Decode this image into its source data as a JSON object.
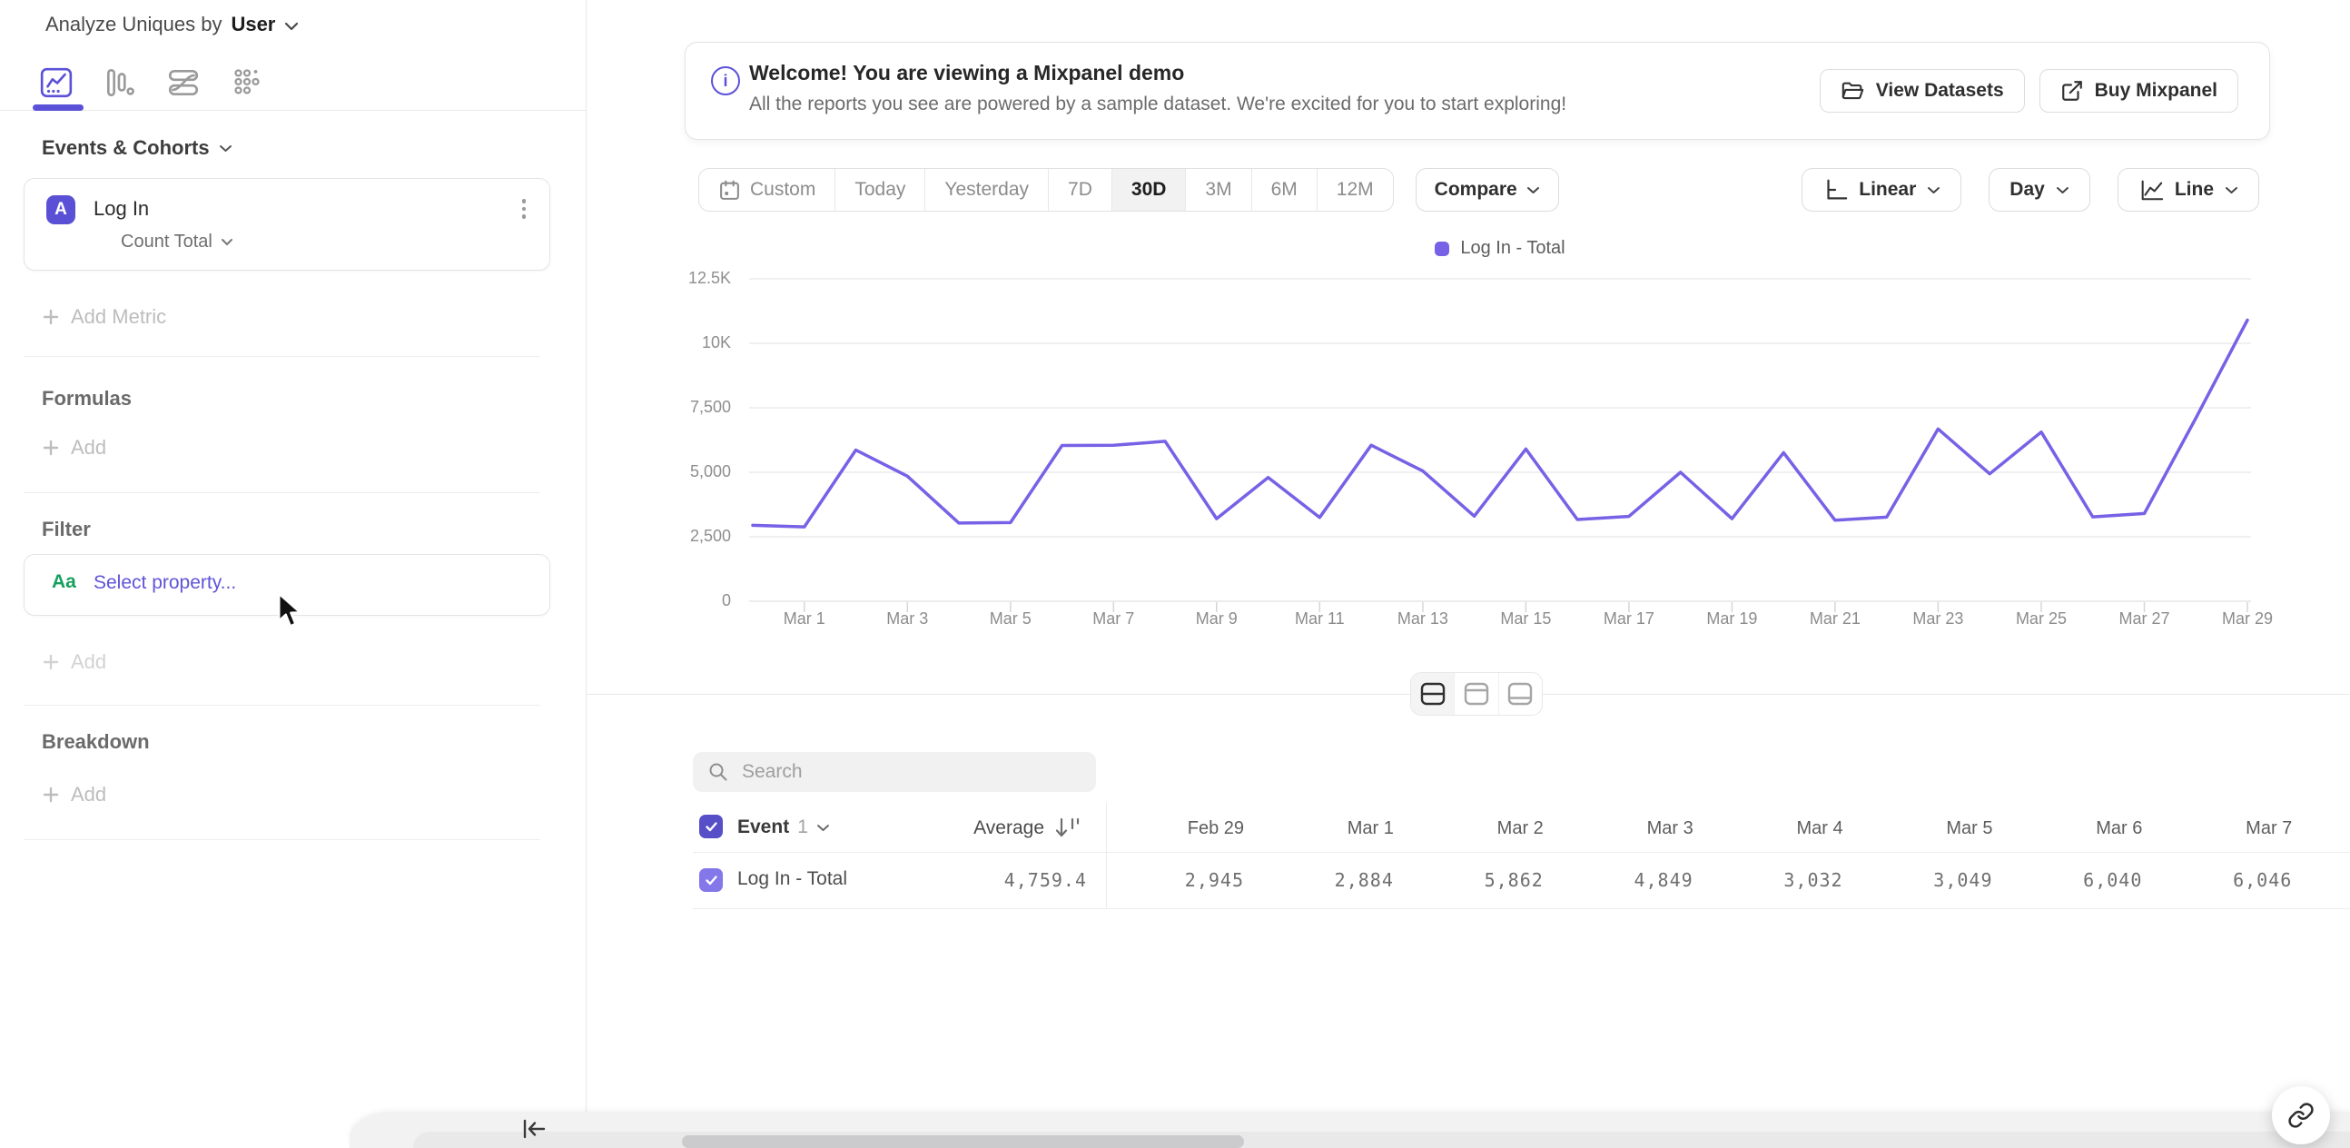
{
  "sidebar": {
    "header": {
      "prefix": "Analyze Uniques by",
      "unit_selector": "User"
    },
    "tabs": [
      {
        "name": "insights",
        "active": true
      },
      {
        "name": "bar-chart",
        "active": false
      },
      {
        "name": "flows",
        "active": false
      },
      {
        "name": "retention",
        "active": false
      }
    ],
    "events": {
      "title": "Events & Cohorts",
      "metric": {
        "badge": "A",
        "event": "Log In",
        "aggregation": "Count Total"
      },
      "add_metric_label": "Add Metric"
    },
    "formulas": {
      "title": "Formulas",
      "add_label": "Add"
    },
    "filter": {
      "title": "Filter",
      "property_type": "Aa",
      "select_label": "Select property...",
      "add_label": "Add"
    },
    "breakdown": {
      "title": "Breakdown",
      "add_label": "Add"
    }
  },
  "banner": {
    "title": "Welcome! You are viewing a Mixpanel demo",
    "subtitle": "All the reports you see are powered by a sample dataset. We're excited for you to start exploring!",
    "buttons": [
      {
        "label": "View Datasets"
      },
      {
        "label": "Buy Mixpanel"
      }
    ]
  },
  "toolbar": {
    "ranges": [
      "Custom",
      "Today",
      "Yesterday",
      "7D",
      "30D",
      "3M",
      "6M",
      "12M"
    ],
    "active_range": "30D",
    "compare_label": "Compare",
    "scale_label": "Linear",
    "interval_label": "Day",
    "chart_type_label": "Line"
  },
  "chart_data": {
    "type": "line",
    "x": [
      "Feb 29",
      "Mar 1",
      "Mar 2",
      "Mar 3",
      "Mar 4",
      "Mar 5",
      "Mar 6",
      "Mar 7",
      "Mar 8",
      "Mar 9",
      "Mar 10",
      "Mar 11",
      "Mar 12",
      "Mar 13",
      "Mar 14",
      "Mar 15",
      "Mar 16",
      "Mar 17",
      "Mar 18",
      "Mar 19",
      "Mar 20",
      "Mar 21",
      "Mar 22",
      "Mar 23",
      "Mar 24",
      "Mar 25",
      "Mar 26",
      "Mar 27",
      "Mar 28",
      "Mar 29"
    ],
    "series": [
      {
        "name": "Log In - Total",
        "color": "#7761e6",
        "values": [
          2945,
          2884,
          5862,
          4849,
          3032,
          3049,
          6040,
          6046,
          6200,
          3200,
          4800,
          3250,
          6050,
          5050,
          3300,
          5900,
          3170,
          3290,
          5000,
          3200,
          5760,
          3140,
          3260,
          6680,
          4940,
          6560,
          3270,
          3400,
          7100,
          10900
        ]
      }
    ],
    "y_ticks": [
      0,
      2500,
      5000,
      7500,
      10000,
      12500
    ],
    "y_tick_labels": [
      "0",
      "2,500",
      "5,000",
      "7,500",
      "10K",
      "12.5K"
    ],
    "ylim": [
      0,
      12500
    ],
    "x_label_every": 2,
    "grid": true,
    "legend_position": "top-center"
  },
  "table": {
    "search_placeholder": "Search",
    "header": {
      "event_label": "Event",
      "event_count": "1",
      "average_label": "Average"
    },
    "date_columns": [
      "Feb 29",
      "Mar 1",
      "Mar 2",
      "Mar 3",
      "Mar 4",
      "Mar 5",
      "Mar 6",
      "Mar 7"
    ],
    "rows": [
      {
        "checked": true,
        "name": "Log In - Total",
        "average": "4,759.4",
        "values": [
          "2,945",
          "2,884",
          "5,862",
          "4,849",
          "3,032",
          "3,049",
          "6,040",
          "6,046"
        ]
      }
    ]
  },
  "colors": {
    "accent": "#5b51d8",
    "series_purple": "#7761e6",
    "checkbox_header": "#564fc8",
    "checkbox_row": "#8377e9",
    "property_green": "#16a05f"
  }
}
